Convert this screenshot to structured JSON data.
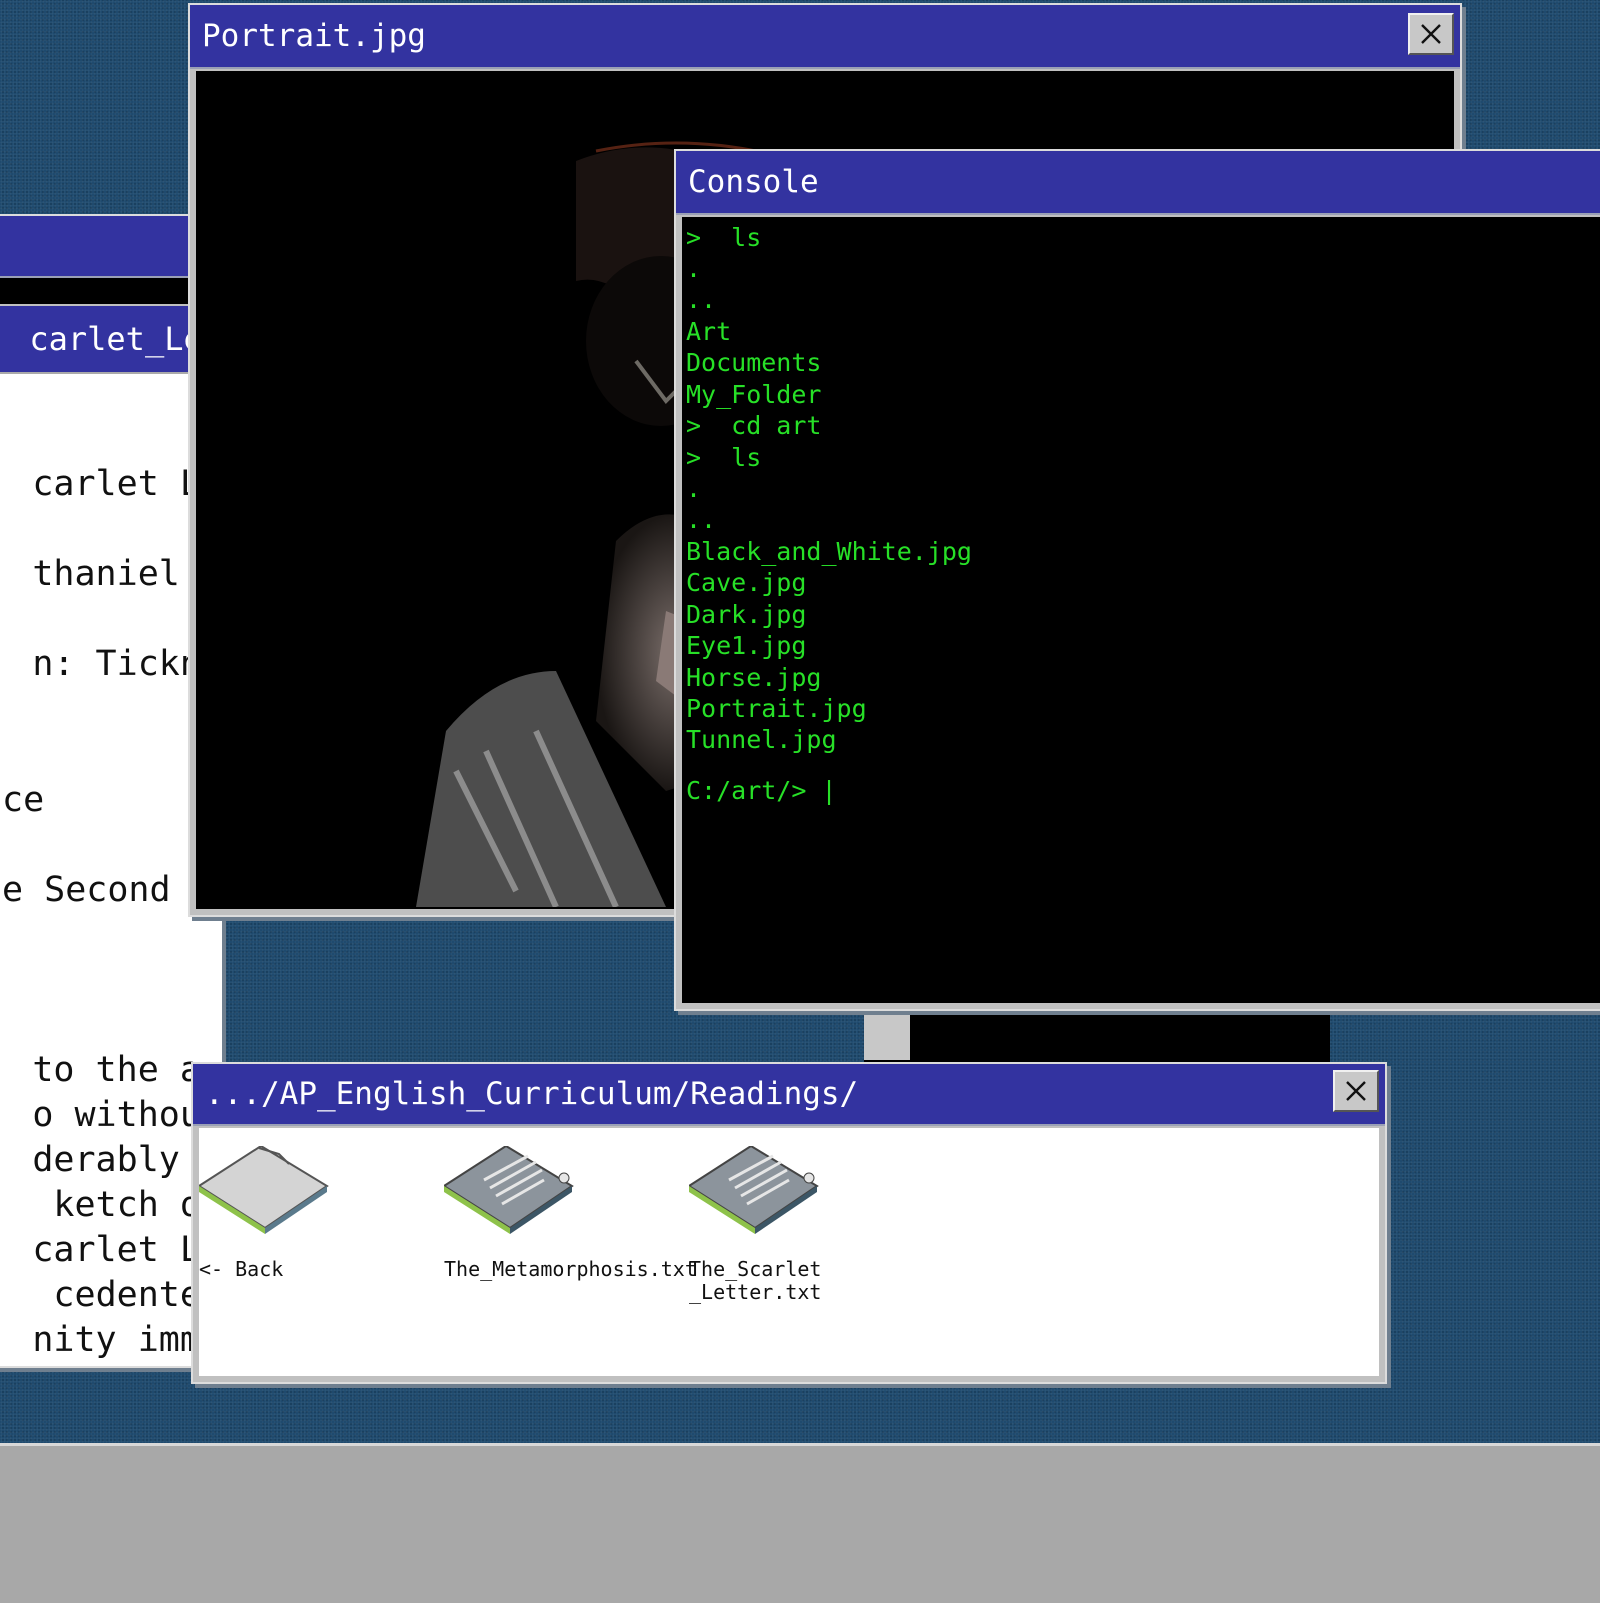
{
  "document_window": {
    "tab_title": "carlet_Let",
    "lines": [
      {
        "text": "carlet Le"
      },
      {
        "text": "thaniel H"
      },
      {
        "text": "n: Tickno"
      },
      {
        "text": "ce"
      },
      {
        "text": "e Second"
      },
      {
        "text": "to the au"
      },
      {
        "text": "o without"
      },
      {
        "text": "derably t"
      },
      {
        "text": "ketch of"
      },
      {
        "text": "carlet Le"
      },
      {
        "text": "cedented"
      },
      {
        "text": "nity imme"
      }
    ]
  },
  "portrait_window": {
    "title": "Portrait.jpg"
  },
  "console_window": {
    "title": "Console",
    "lines": [
      ">  ls",
      ".",
      "..",
      "Art",
      "Documents",
      "My_Folder",
      ">  cd art",
      ">  ls",
      ".",
      "..",
      "Black_and_White.jpg",
      "Cave.jpg",
      "Dark.jpg",
      "Eye1.jpg",
      "Horse.jpg",
      "Portrait.jpg",
      "Tunnel.jpg"
    ],
    "prompt": "C:/art/> |"
  },
  "explorer_window": {
    "title": ".../AP_English_Curriculum/Readings/",
    "items": [
      {
        "label": "<- Back",
        "icon": "folder-icon"
      },
      {
        "label": "The_Metamorphosis.txt",
        "icon": "text-file-icon"
      },
      {
        "label": "The_Scarlet\n_Letter.txt",
        "icon": "text-file-icon"
      }
    ]
  },
  "colors": {
    "titlebar": "#3333a0",
    "console_text": "#27e027",
    "desktop": "#1f4a6e",
    "taskbar": "#a8a8a8"
  }
}
